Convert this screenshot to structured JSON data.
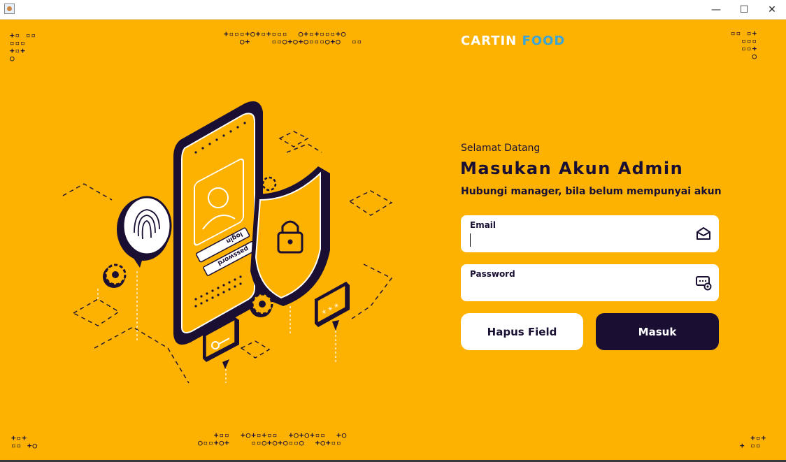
{
  "window": {
    "controls": {
      "minimize": "—",
      "maximize": "☐",
      "close": "✕"
    }
  },
  "brand": {
    "part1": "CARTIN",
    "part2": "FOOD",
    "color1": "#FFFFFF",
    "color2": "#3AA6D8"
  },
  "login": {
    "welcome": "Selamat Datang",
    "heading": "Masukan Akun Admin",
    "subtitle": "Hubungi manager, bila belum mempunyai akun",
    "email_label": "Email",
    "email_value": "",
    "password_label": "Password",
    "password_value": "",
    "clear_button": "Hapus Field",
    "submit_button": "Masuk"
  },
  "illustration": {
    "login_text": "login",
    "password_text": "password",
    "icons": [
      "phone-icon",
      "shield-lock-icon",
      "fingerprint-icon",
      "gear-icon",
      "key-icon",
      "password-bubble-icon"
    ]
  },
  "decorations": {
    "top_left": "+▫ ▫▫\n▫▫▫\n+▫+\n○",
    "top_center": "+▫▫▫+○+▫+▫▫▫  ○+▫+▫▫▫+○\n   ○+    ▫▫○+○+○▫▫▫○+○  ▫▫",
    "top_right": "▫▫ ▫+\n  ▫▫▫\n  ▫▫+\n    ○",
    "bottom_left": "+▫+\n▫▫ +○",
    "bottom_center": "   +▫▫  +○+▫+▫▫  +○+○+▫▫  +○\n○▫▫+○+    ▫▫○+○+○▫▫○  +○+▫▫",
    "bottom_right": "  +▫+\n+ ▫▫"
  },
  "colors": {
    "background": "#FDB201",
    "dark": "#1A0F33",
    "white": "#FFFFFF"
  }
}
